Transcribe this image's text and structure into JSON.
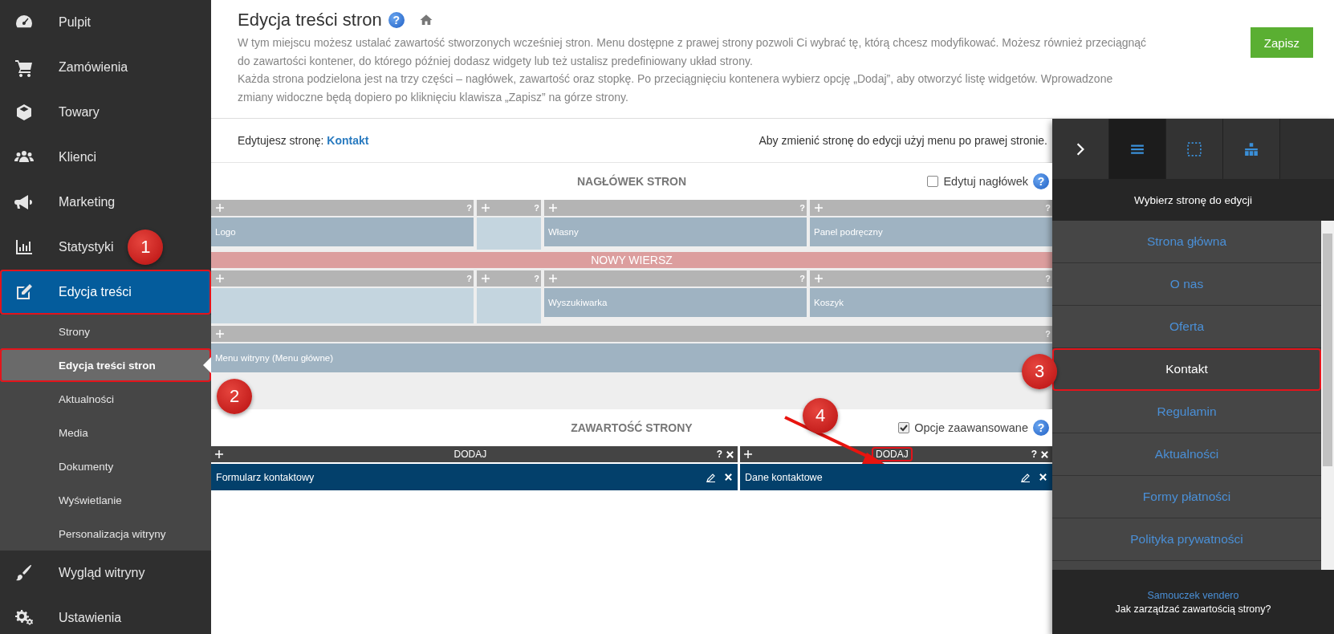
{
  "sidebar": {
    "items": [
      {
        "label": "Pulpit",
        "selected": false,
        "outlined": false
      },
      {
        "label": "Zamówienia",
        "selected": false,
        "outlined": false
      },
      {
        "label": "Towary",
        "selected": false,
        "outlined": false
      },
      {
        "label": "Klienci",
        "selected": false,
        "outlined": false
      },
      {
        "label": "Marketing",
        "selected": false,
        "outlined": false
      },
      {
        "label": "Statystyki",
        "selected": false,
        "outlined": false
      },
      {
        "label": "Edycja treści",
        "selected": true,
        "outlined": true,
        "children": [
          {
            "label": "Strony",
            "selected": false,
            "outlined": false
          },
          {
            "label": "Edycja treści stron",
            "selected": true,
            "outlined": true
          },
          {
            "label": "Aktualności",
            "selected": false,
            "outlined": false
          },
          {
            "label": "Media",
            "selected": false,
            "outlined": false
          },
          {
            "label": "Dokumenty",
            "selected": false,
            "outlined": false
          },
          {
            "label": "Wyświetlanie",
            "selected": false,
            "outlined": false
          },
          {
            "label": "Personalizacja witryny",
            "selected": false,
            "outlined": false
          }
        ]
      },
      {
        "label": "Wygląd witryny",
        "selected": false,
        "outlined": false
      },
      {
        "label": "Ustawienia",
        "selected": false,
        "outlined": false
      }
    ]
  },
  "page_header": {
    "title": "Edycja treści stron",
    "help": "?",
    "description": [
      "W tym miejscu możesz ustalać zawartość stworzonych wcześniej stron. Menu dostępne z prawej strony pozwoli Ci wybrać tę, którą chcesz modyfikować. Możesz również przeciągnąć do zawartości kontener, do którego później dodasz widgety lub też ustalisz predefiniowany układ strony.",
      "Każda strona podzielona jest na trzy części – nagłówek, zawartość oraz stopkę. Po przeciągnięciu kontenera wybierz opcję „Dodaj”, aby otworzyć listę widgetów. Wprowadzone zmiany widoczne będą dopiero po kliknięciu klawisza „Zapisz” na górze strony."
    ],
    "save_button": "Zapisz"
  },
  "editing_bar": {
    "label": "Edytujesz stronę:",
    "page": "Kontakt",
    "hint": "Aby zmienić stronę do edycji użyj menu po prawej stronie."
  },
  "header_section": {
    "title": "NAGŁÓWEK STRON",
    "checkbox": {
      "label": "Edytuj nagłówek",
      "checked": false
    },
    "help": "?",
    "rows": [
      {
        "kind": "cells",
        "cells": [
          {
            "label": "Logo",
            "help": "?"
          },
          {
            "help": "?"
          },
          {
            "label": "Własny",
            "help": "?"
          },
          {
            "label": "Panel podręczny",
            "help": "?"
          }
        ]
      },
      {
        "kind": "new_row",
        "label": "NOWY WIERSZ"
      },
      {
        "kind": "cells",
        "cells": [
          {
            "help": "?"
          },
          {
            "help": "?"
          },
          {
            "label": "Wyszukiwarka",
            "help": "?"
          },
          {
            "label": "Koszyk",
            "help": "?"
          }
        ]
      },
      {
        "kind": "cells",
        "cells": [
          {
            "label": "Menu witryny (Menu główne)",
            "help": "?"
          }
        ]
      }
    ]
  },
  "content_section": {
    "title": "ZAWARTOŚĆ STRONY",
    "checkbox": {
      "label": "Opcje zaawansowane",
      "checked": true
    },
    "help": "?",
    "columns": [
      {
        "header": "DODAJ",
        "help": "?",
        "outlined": false,
        "widgets": [
          {
            "label": "Formularz kontaktowy"
          }
        ]
      },
      {
        "header": "DODAJ",
        "help": "?",
        "outlined": true,
        "widgets": [
          {
            "label": "Dane kontaktowe"
          }
        ]
      }
    ]
  },
  "panel": {
    "tabs": [
      {
        "kind": "collapse",
        "selected": false
      },
      {
        "kind": "list",
        "selected": true
      },
      {
        "kind": "layout",
        "selected": false
      },
      {
        "kind": "structure",
        "selected": false
      }
    ],
    "title": "Wybierz stronę do edycji",
    "pages": [
      {
        "label": "Strona główna",
        "selected": false,
        "outlined": false
      },
      {
        "label": "O nas",
        "selected": false,
        "outlined": false
      },
      {
        "label": "Oferta",
        "selected": false,
        "outlined": false
      },
      {
        "label": "Kontakt",
        "selected": true,
        "outlined": true
      },
      {
        "label": "Regulamin",
        "selected": false,
        "outlined": false
      },
      {
        "label": "Aktualności",
        "selected": false,
        "outlined": false
      },
      {
        "label": "Formy płatności",
        "selected": false,
        "outlined": false
      },
      {
        "label": "Polityka prywatności",
        "selected": false,
        "outlined": false
      }
    ],
    "footer_link": "Samouczek vendero",
    "footer_text": "Jak zarządzać zawartością strony?"
  },
  "annotations": [
    {
      "number": "1"
    },
    {
      "number": "2"
    },
    {
      "number": "3"
    },
    {
      "number": "4"
    }
  ]
}
